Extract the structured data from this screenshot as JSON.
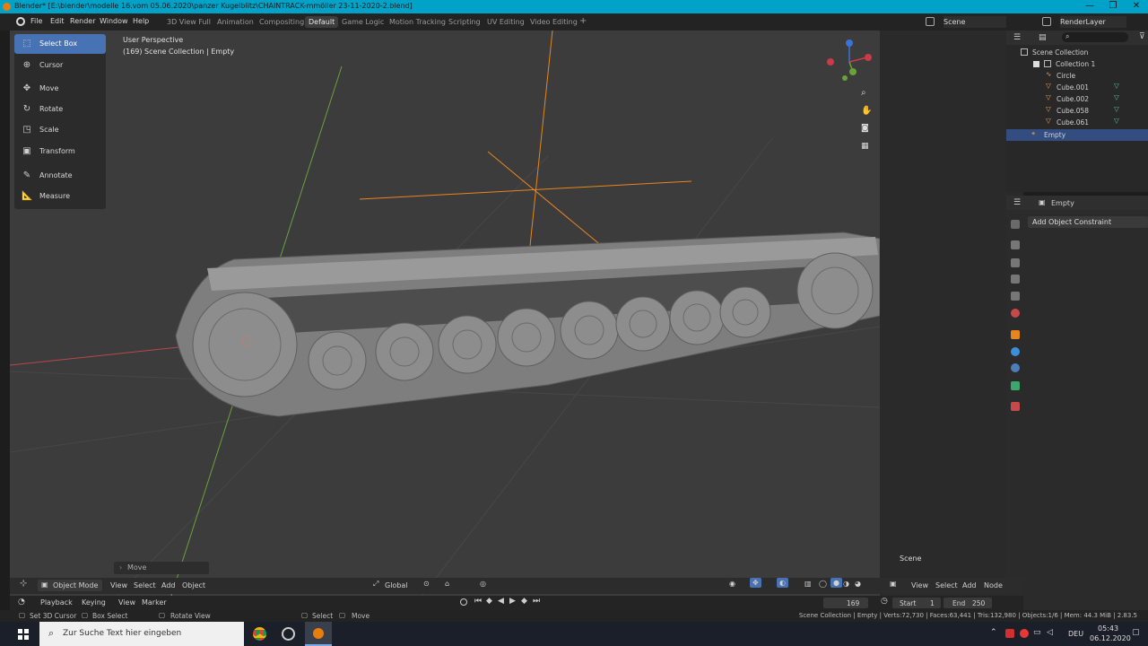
{
  "window": {
    "title": "Blender* [E:\\blender\\modelle 16.vom 05.06.2020\\panzer Kugelblitz\\CHAINTRACK-mmöller 23-11-2020-2.blend]",
    "controls": [
      "—",
      "❐",
      "✕"
    ]
  },
  "menus": [
    "File",
    "Edit",
    "Render",
    "Window",
    "Help"
  ],
  "workspaces": [
    {
      "label": "3D View Full",
      "active": false
    },
    {
      "label": "Animation",
      "active": false
    },
    {
      "label": "Compositing",
      "active": false
    },
    {
      "label": "Default",
      "active": true
    },
    {
      "label": "Game Logic",
      "active": false
    },
    {
      "label": "Motion Tracking",
      "active": false
    },
    {
      "label": "Scripting",
      "active": false
    },
    {
      "label": "UV Editing",
      "active": false
    },
    {
      "label": "Video Editing",
      "active": false
    }
  ],
  "add_workspace": "+",
  "scene_label": "Scene",
  "render_layer": "RenderLayer",
  "tools": [
    {
      "label": "Select Box",
      "icon": "select-box-icon",
      "active": true
    },
    {
      "label": "Cursor",
      "icon": "cursor-icon",
      "active": false
    },
    {
      "label": "Move",
      "icon": "move-icon",
      "active": false
    },
    {
      "label": "Rotate",
      "icon": "rotate-icon",
      "active": false
    },
    {
      "label": "Scale",
      "icon": "scale-icon",
      "active": false
    },
    {
      "label": "Transform",
      "icon": "transform-icon",
      "active": false
    },
    {
      "label": "Annotate",
      "icon": "annotate-icon",
      "active": false
    },
    {
      "label": "Measure",
      "icon": "measure-icon",
      "active": false
    }
  ],
  "viewport": {
    "perspective": "User Perspective",
    "collection_info": "(169) Scene Collection | Empty",
    "last_operator": "Move",
    "mode": "Object Mode",
    "menus": [
      "View",
      "Select",
      "Add",
      "Object"
    ],
    "orientation": "Global"
  },
  "outliner": {
    "root": "Scene Collection",
    "items": [
      {
        "label": "Collection 1",
        "indent": 1,
        "selected": false,
        "type": "collection"
      },
      {
        "label": "Circle",
        "indent": 2,
        "selected": false,
        "type": "curve"
      },
      {
        "label": "Cube.001",
        "indent": 2,
        "selected": false,
        "type": "mesh"
      },
      {
        "label": "Cube.002",
        "indent": 2,
        "selected": false,
        "type": "mesh"
      },
      {
        "label": "Cube.058",
        "indent": 2,
        "selected": false,
        "type": "mesh"
      },
      {
        "label": "Cube.061",
        "indent": 2,
        "selected": false,
        "type": "mesh"
      },
      {
        "label": "Empty",
        "indent": 1,
        "selected": true,
        "type": "empty"
      }
    ]
  },
  "properties": {
    "object_name": "Empty",
    "add_constraint": "Add Object Constraint"
  },
  "node_editor": {
    "scene_label": "Scene",
    "menus": [
      "View",
      "Select",
      "Add",
      "Node"
    ]
  },
  "timeline": {
    "menus": [
      "Playback",
      "Keying",
      "View",
      "Marker"
    ],
    "current_frame": "169",
    "start_label": "Start",
    "start": "1",
    "end_label": "End",
    "end": "250"
  },
  "statusbar": {
    "left": [
      {
        "label": "Set 3D Cursor"
      },
      {
        "label": "Box Select"
      },
      {
        "label": "Rotate View"
      },
      {
        "label": "Select"
      },
      {
        "label": "Move"
      }
    ],
    "stats": "Scene Collection | Empty | Verts:72,730 | Faces:63,441 | Tris:132,980 | Objects:1/6 | Mem: 44.3 MiB | 2.83.5"
  },
  "taskbar": {
    "search_placeholder": "Zur Suche Text hier eingeben",
    "lang": "DEU",
    "time": "05:43",
    "date": "06.12.2020"
  },
  "colors": {
    "accent": "#4772b3",
    "titlebar": "#00a2c8",
    "selected_row": "#334d80"
  }
}
